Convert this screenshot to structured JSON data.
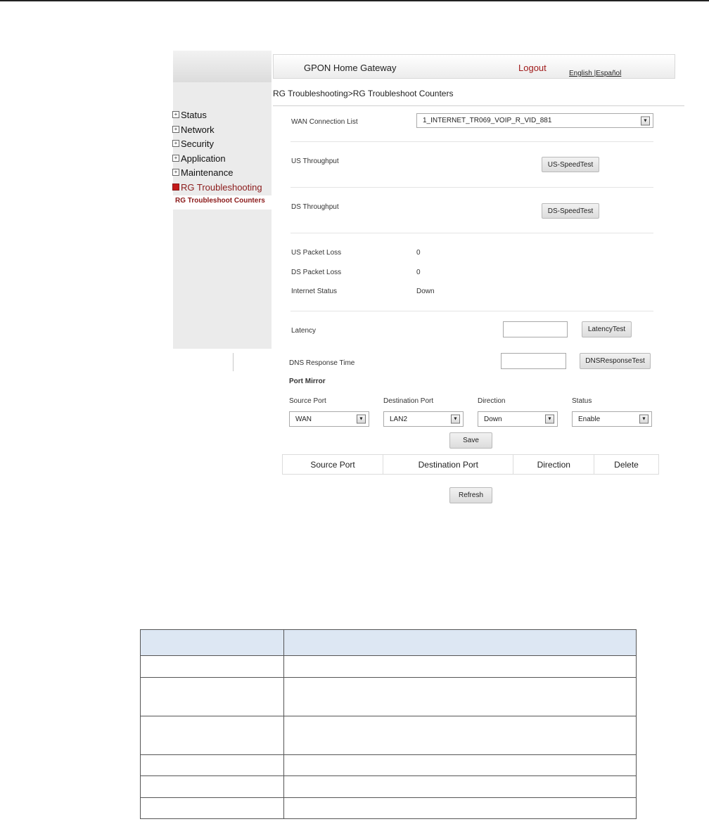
{
  "header": {
    "title": "GPON Home Gateway",
    "logout": "Logout",
    "lang_english": "English",
    "lang_sep": "|",
    "lang_spanish": "Español"
  },
  "breadcrumb": "RG Troubleshooting>RG Troubleshoot Counters",
  "sidebar": {
    "items": [
      {
        "label": "Status",
        "icon": "plus-icon"
      },
      {
        "label": "Network",
        "icon": "plus-icon"
      },
      {
        "label": "Security",
        "icon": "plus-icon"
      },
      {
        "label": "Application",
        "icon": "plus-icon"
      },
      {
        "label": "Maintenance",
        "icon": "plus-icon"
      },
      {
        "label": "RG Troubleshooting",
        "icon": "minus-icon",
        "active": true
      }
    ],
    "sub_item": "RG Troubleshoot Counters"
  },
  "form": {
    "wan_label": "WAN Connection List",
    "wan_value": "1_INTERNET_TR069_VOIP_R_VID_881",
    "us_throughput_label": "US Throughput",
    "us_speedtest": "US-SpeedTest",
    "ds_throughput_label": "DS Throughput",
    "ds_speedtest": "DS-SpeedTest",
    "us_packet_loss_label": "US Packet Loss",
    "us_packet_loss_value": "0",
    "ds_packet_loss_label": "DS Packet Loss",
    "ds_packet_loss_value": "0",
    "internet_status_label": "Internet Status",
    "internet_status_value": "Down",
    "latency_label": "Latency",
    "latency_test": "LatencyTest",
    "dns_label": "DNS Response Time",
    "dns_test": "DNSResponseTest"
  },
  "port_mirror": {
    "title": "Port Mirror",
    "source_port_label": "Source Port",
    "source_port_value": "WAN",
    "dest_port_label": "Destination Port",
    "dest_port_value": "LAN2",
    "direction_label": "Direction",
    "direction_value": "Down",
    "status_label": "Status",
    "status_value": "Enable",
    "save": "Save",
    "table_headers": [
      "Source Port",
      "Destination Port",
      "Direction",
      "Delete"
    ],
    "refresh": "Refresh"
  },
  "colors": {
    "accent_red": "#a01a1a",
    "table_header_bg": "#dde7f3"
  }
}
